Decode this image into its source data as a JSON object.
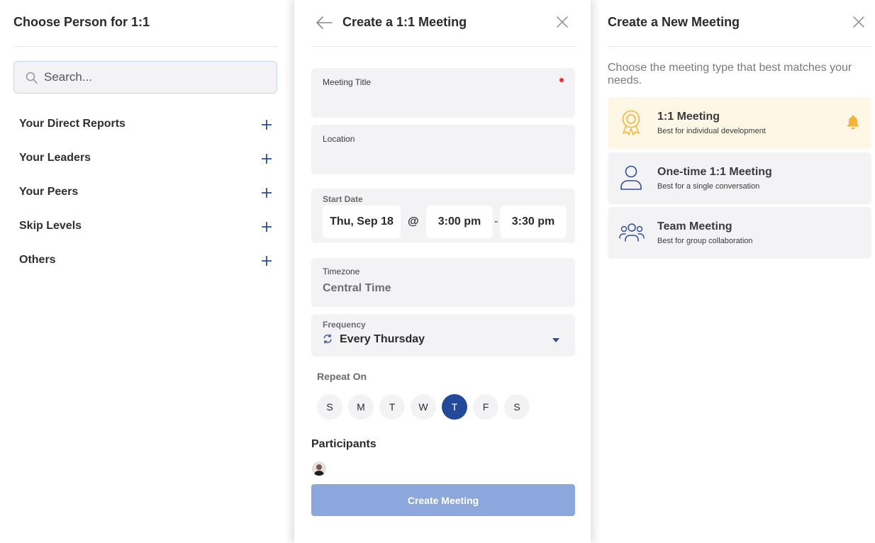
{
  "left": {
    "title": "Choose Person for 1:1",
    "search_placeholder": "Search...",
    "groups": [
      "Your Direct Reports",
      "Your Leaders",
      "Your Peers",
      "Skip Levels",
      "Others"
    ]
  },
  "mid": {
    "title": "Create a 1:1 Meeting",
    "meeting_title_label": "Meeting Title",
    "location_label": "Location",
    "start_date_label": "Start Date",
    "start_date_value": "Thu, Sep 18",
    "at_symbol": "@",
    "start_time": "3:00 pm",
    "time_separator": "-",
    "end_time": "3:30 pm",
    "timezone_label": "Timezone",
    "timezone_value": "Central Time",
    "frequency_label": "Frequency",
    "frequency_value": "Every Thursday",
    "repeat_on_label": "Repeat On",
    "days": [
      "S",
      "M",
      "T",
      "W",
      "T",
      "F",
      "S"
    ],
    "selected_day_index": 4,
    "participants_label": "Participants",
    "create_button": "Create Meeting"
  },
  "right": {
    "title": "Create a New Meeting",
    "intro": "Choose the meeting type that best matches your needs.",
    "cards": [
      {
        "title": "1:1 Meeting",
        "subtitle": "Best for individual development",
        "icon": "award-ribbon-icon"
      },
      {
        "title": "One-time 1:1 Meeting",
        "subtitle": "Best for a single conversation",
        "icon": "person-icon"
      },
      {
        "title": "Team Meeting",
        "subtitle": "Best for group collaboration",
        "icon": "group-icon"
      }
    ]
  },
  "colors": {
    "accent": "#234a98",
    "button_disabled": "#8ca7dc",
    "highlight_card": "#fff7e6",
    "award_icon": "#f2b53a",
    "required_dot": "#e5303a"
  }
}
